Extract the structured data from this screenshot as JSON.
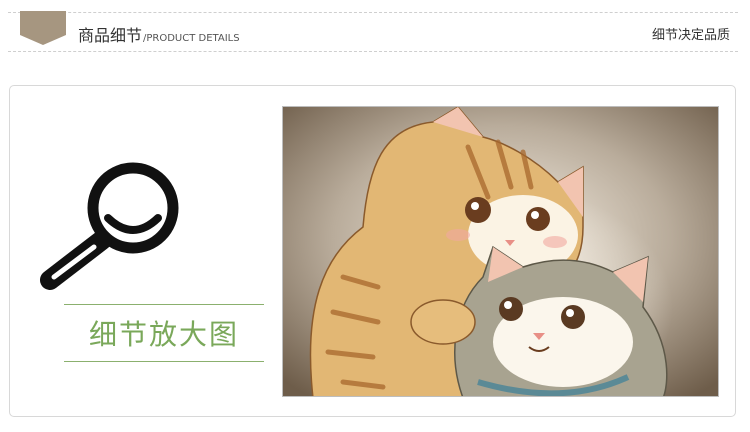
{
  "header": {
    "title": "商品细节",
    "subtitle": "/PRODUCT DETAILS",
    "right_text": "细节决定品质"
  },
  "detail": {
    "zoom_label": "细节放大图"
  },
  "colors": {
    "flag": "#a69680",
    "accent_green": "#7aa85a",
    "magnifier": "#111111"
  },
  "icons": [
    "magnifier-icon",
    "header-flag-icon"
  ]
}
